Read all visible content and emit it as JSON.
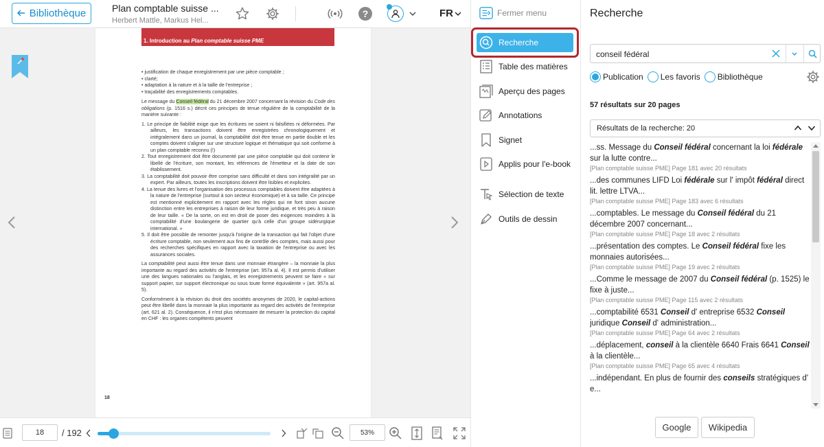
{
  "topbar": {
    "back_label": "Bibliothèque",
    "book_title": "Plan comptable suisse ...",
    "book_authors": "Herbert Mattle, Markus Hel...",
    "language": "FR"
  },
  "reader": {
    "chapter_heading_prefix": "1. Introduction au ",
    "chapter_heading_italic": "Plan comptable suisse PME",
    "page_number": "18",
    "bullets": [
      "justification de chaque enregistrement par une pièce comptable ;",
      "clarté;",
      "adaptation à la nature et à la taille de l'entreprise ;",
      "traçabilité des enregistrements comptables."
    ],
    "intro_before": "Le message du ",
    "intro_highlight": "Conseil fédéral",
    "intro_after_1": " du 21 décembre 2007 concernant la révision du ",
    "intro_italic": "Code des obligations",
    "intro_after_2": " (p. 1516 s.) décrit ces principes de tenue régulière de la comptabilité de la manière suivante :",
    "numbered": [
      "1. Le principe de fiabilité exige que les écritures ne soient ni falsifiées ni déformées. Par ailleurs, les transactions doivent être enregistrées chronologiquement et intégralement dans un journal, la comptabilité doit être tenue en partie double et les comptes doivent s'aligner sur une structure logique et thématique qui soit conforme à un plan comptable reconnu (!)",
      "2. Tout enregistrement doit être documenté par une pièce comptable qui doit contenir le libellé de l'écriture, son montant, les références de l'émetteur et la date de son établissement.",
      "3. La comptabilité doit pouvoir être comprise sans difficulté et dans son intégralité par un expert. Par ailleurs, toutes les inscriptions doivent être lisibles et explicites.",
      "4. La tenue des livres et l'organisation des processus comptables doivent être adaptées à la nature de l'entreprise (surtout à son secteur économique) et à sa taille. Ce principe est mentionné explicitement en rapport avec les règles qui ne font sinon aucune distinction entre les entreprises à raison de leur forme juridique, et très peu à raison de leur taille. « De la sorte, on est en droit de poser des exigences moindres à la comptabilité d'une boulangerie de quartier qu'à celle d'un groupe sidérurgique international. »",
      "5. Il doit être possible de remonter jusqu'à l'origine de la transaction qui fait l'objet d'une écriture comptable, non seulement aux fins de contrôle des comptes, mais aussi pour des recherches spécifiques en rapport avec la taxation de l'entreprise ou avec les assurances sociales."
    ],
    "para_currency": "La comptabilité peut aussi être tenue dans une monnaie étrangère – la monnaie la plus importante au regard des activités de l'entreprise (art. 957a al. 4). Il est permis d'utiliser une des langues nationales ou l'anglais, et les enregistrements peuvent se faire « sur support papier, sur support électronique ou sous toute forme équivalente » (art. 957a al. 5).",
    "para_revision": "Conformément à la révision du droit des sociétés anonymes de 2020, le capital-actions peut être libellé dans la monnaie la plus importante au regard des activités de l'entreprise (art. 621 al. 2). Conséquence, il n'est plus nécessaire de mesurer la protection du capital en CHF : les organes compétents peuvent"
  },
  "bottombar": {
    "current_page": "18",
    "total_pages": "/ 192",
    "progress": 0.09,
    "zoom": "53%"
  },
  "menu": {
    "close_label": "Fermer menu",
    "items": [
      {
        "label": "Recherche",
        "icon": "search-circle-icon"
      },
      {
        "label": "Table des matières",
        "icon": "list-icon"
      },
      {
        "label": "Aperçu des pages",
        "icon": "pages-preview-icon"
      },
      {
        "label": "Annotations",
        "icon": "pencil-note-icon"
      },
      {
        "label": "Signet",
        "icon": "bookmark-icon"
      },
      {
        "label": "Applis pour l'e-book",
        "icon": "apps-icon"
      },
      {
        "label": "Sélection de texte",
        "icon": "text-select-icon"
      },
      {
        "label": "Outils de dessin",
        "icon": "pen-icon"
      }
    ]
  },
  "search": {
    "title": "Recherche",
    "query": "conseil fédéral",
    "scopes": [
      {
        "label": "Publication",
        "selected": true
      },
      {
        "label": "Les favoris",
        "selected": false
      },
      {
        "label": "Bibliothèque",
        "selected": false
      }
    ],
    "result_count": "57 résultats sur 20 pages",
    "results_select": "Résultats de la recherche: 20",
    "results": [
      {
        "parts": [
          [
            "...ss. Message du ",
            false
          ],
          [
            "Conseil fédéral",
            true
          ],
          [
            " concernant la loi ",
            false
          ],
          [
            "fédérale",
            true
          ],
          [
            " sur la lutte contre...",
            false
          ]
        ],
        "meta": "[Plan comptable suisse PME] Page 181 avec 20 résultats"
      },
      {
        "parts": [
          [
            "...des communes LIFD Loi ",
            false
          ],
          [
            "fédérale",
            true
          ],
          [
            " sur l' impôt ",
            false
          ],
          [
            "fédéral",
            true
          ],
          [
            " direct lit. lettre LTVA...",
            false
          ]
        ],
        "meta": "[Plan comptable suisse PME] Page 183 avec 6 résultats"
      },
      {
        "parts": [
          [
            "...comptables. Le message du ",
            false
          ],
          [
            "Conseil fédéral",
            true
          ],
          [
            " du 21 décembre 2007 concernant...",
            false
          ]
        ],
        "meta": "[Plan comptable suisse PME] Page 18 avec 2 résultats"
      },
      {
        "parts": [
          [
            "...présentation des comptes. Le ",
            false
          ],
          [
            "Conseil fédéral",
            true
          ],
          [
            " fixe les monnaies autorisées...",
            false
          ]
        ],
        "meta": "[Plan comptable suisse PME] Page 19 avec 2 résultats"
      },
      {
        "parts": [
          [
            "...Comme le message de 2007 du ",
            false
          ],
          [
            "Conseil fédéral",
            true
          ],
          [
            " (p. 1525) le fixe à juste...",
            false
          ]
        ],
        "meta": "[Plan comptable suisse PME] Page 115 avec 2 résultats"
      },
      {
        "parts": [
          [
            "...comptabilité 6531 ",
            false
          ],
          [
            "Conseil",
            true
          ],
          [
            " d' entreprise 6532 ",
            false
          ],
          [
            "Conseil",
            true
          ],
          [
            " juridique ",
            false
          ],
          [
            "Conseil",
            true
          ],
          [
            " d' administration...",
            false
          ]
        ],
        "meta": "[Plan comptable suisse PME] Page 64 avec 2 résultats"
      },
      {
        "parts": [
          [
            "...déplacement, ",
            false
          ],
          [
            "conseil",
            true
          ],
          [
            " à la clientèle 6640 Frais 6641 ",
            false
          ],
          [
            "Conseil",
            true
          ],
          [
            " à la clientèle...",
            false
          ]
        ],
        "meta": "[Plan comptable suisse PME] Page 65 avec 4 résultats"
      },
      {
        "parts": [
          [
            "...indépendant. En plus de fournir des ",
            false
          ],
          [
            "conseils",
            true
          ],
          [
            " stratégiques d' e...",
            false
          ]
        ],
        "meta": ""
      }
    ],
    "google_label": "Google",
    "wikipedia_label": "Wikipedia"
  },
  "colors": {
    "accent": "#2aa7e0",
    "active_menu": "#3db2e8",
    "frame_red": "#b3272d",
    "chapter_red": "#c8373d",
    "highlight": "#c6e8a0"
  }
}
